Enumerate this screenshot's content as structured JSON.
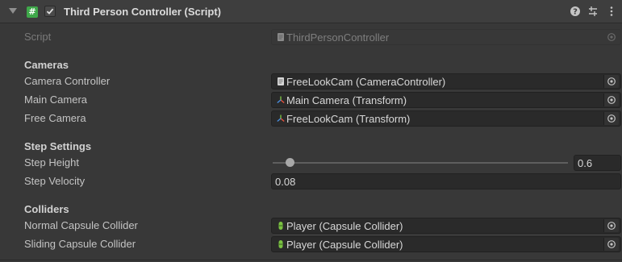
{
  "header": {
    "title": "Third Person Controller (Script)",
    "enabled": true,
    "help_icon": "help-icon",
    "preset_icon": "presets-icon",
    "menu_icon": "kebab-menu-icon"
  },
  "script_row": {
    "label": "Script",
    "value": "ThirdPersonController",
    "icon": "script-asset-icon"
  },
  "sections": {
    "cameras": {
      "title": "Cameras",
      "camera_controller": {
        "label": "Camera Controller",
        "value": "FreeLookCam (CameraController)",
        "icon": "script-component-icon"
      },
      "main_camera": {
        "label": "Main Camera",
        "value": "Main Camera (Transform)",
        "icon": "transform-icon"
      },
      "free_camera": {
        "label": "Free Camera",
        "value": "FreeLookCam (Transform)",
        "icon": "transform-icon"
      }
    },
    "step_settings": {
      "title": "Step Settings",
      "step_height": {
        "label": "Step Height",
        "value": "0.6",
        "fraction": 0.06
      },
      "step_velocity": {
        "label": "Step Velocity",
        "value": "0.08"
      }
    },
    "colliders": {
      "title": "Colliders",
      "normal_capsule": {
        "label": "Normal Capsule Collider",
        "value": "Player (Capsule Collider)",
        "icon": "capsule-collider-icon"
      },
      "sliding_capsule": {
        "label": "Sliding Capsule Collider",
        "value": "Player (Capsule Collider)",
        "icon": "capsule-collider-icon"
      }
    }
  },
  "colors": {
    "background": "#383838",
    "field_background": "#2a2a2a",
    "script_icon_green": "#3fa84a"
  }
}
